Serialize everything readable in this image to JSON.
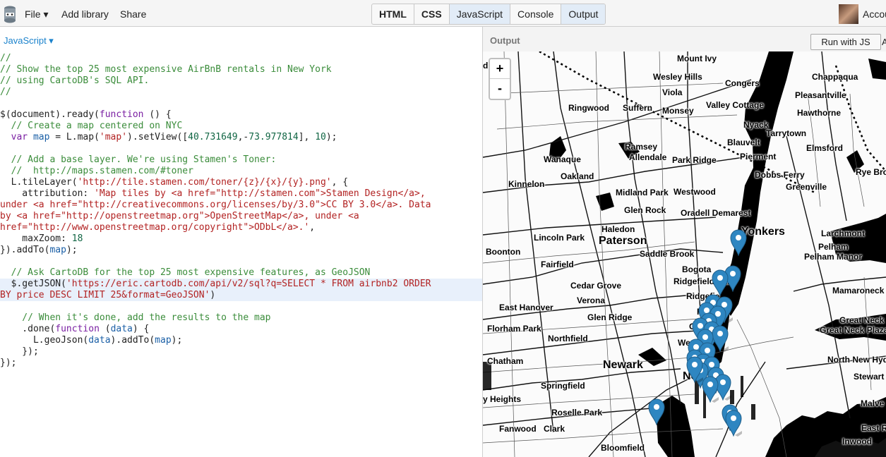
{
  "toolbar": {
    "file_label": "File ▾",
    "add_library_label": "Add library",
    "share_label": "Share",
    "tabs": [
      "HTML",
      "CSS",
      "JavaScript",
      "Console",
      "Output"
    ],
    "account_label": "Accou"
  },
  "editor": {
    "language": "JavaScript ▾",
    "code_lines": [
      [
        [
          "//",
          "c"
        ]
      ],
      [
        [
          "// Show the top 25 most expensive AirBnB rentals in New York",
          "c"
        ]
      ],
      [
        [
          "// using CartoDB's SQL API.",
          "c"
        ]
      ],
      [
        [
          "//",
          "c"
        ]
      ],
      [],
      [
        [
          "$(document).ready(",
          "p"
        ],
        [
          "function",
          "k"
        ],
        [
          " () {",
          "p"
        ]
      ],
      [
        [
          "  // Create a map centered on NYC",
          "c"
        ]
      ],
      [
        [
          "  ",
          "p"
        ],
        [
          "var",
          "k"
        ],
        [
          " ",
          "p"
        ],
        [
          "map",
          "v"
        ],
        [
          " = L.map(",
          "p"
        ],
        [
          "'map'",
          "s"
        ],
        [
          ").setView([",
          "p"
        ],
        [
          "40.731649",
          "n"
        ],
        [
          ",-",
          "p"
        ],
        [
          "73.977814",
          "n"
        ],
        [
          "], ",
          "p"
        ],
        [
          "10",
          "n"
        ],
        [
          ");",
          "p"
        ]
      ],
      [],
      [
        [
          "  // Add a base layer. We're using Stamen's Toner:",
          "c"
        ]
      ],
      [
        [
          "  //  http://maps.stamen.com/#toner",
          "c"
        ]
      ],
      [
        [
          "  L.tileLayer(",
          "p"
        ],
        [
          "'http://tile.stamen.com/toner/{z}/{x}/{y}.png'",
          "s"
        ],
        [
          ", {",
          "p"
        ]
      ],
      [
        [
          "    attribution: ",
          "p"
        ],
        [
          "'Map tiles by <a href=\"http://stamen.com\">Stamen Design</a>,",
          "s"
        ]
      ],
      [
        [
          "under <a href=\"http://creativecommons.org/licenses/by/3.0\">CC BY 3.0</a>. Data",
          "s"
        ]
      ],
      [
        [
          "by <a href=\"http://openstreetmap.org\">OpenStreetMap</a>, under <a",
          "s"
        ]
      ],
      [
        [
          "href=\"http://www.openstreetmap.org/copyright\">ODbL</a>.'",
          "s"
        ],
        [
          ",",
          "p"
        ]
      ],
      [
        [
          "    maxZoom: ",
          "p"
        ],
        [
          "18",
          "n"
        ]
      ],
      [
        [
          "}).addTo(",
          "p"
        ],
        [
          "map",
          "v"
        ],
        [
          ");",
          "p"
        ]
      ],
      [],
      [
        [
          "  // Ask CartoDB for the top 25 most expensive features, as GeoJSON",
          "c"
        ]
      ],
      [
        [
          "  $.getJSON(",
          "p"
        ],
        [
          "'https://eric.cartodb.com/api/v2/sql?q=SELECT * FROM airbnb2 ORDER",
          "s"
        ]
      ],
      [
        [
          "BY price DESC LIMIT 25&format=GeoJSON'",
          "s"
        ],
        [
          ")",
          "p"
        ]
      ],
      [],
      [
        [
          "    // When it's done, add the results to the map",
          "c"
        ]
      ],
      [
        [
          "    .done(",
          "p"
        ],
        [
          "function",
          "k"
        ],
        [
          " (",
          "p"
        ],
        [
          "data",
          "v"
        ],
        [
          ") {",
          "p"
        ]
      ],
      [
        [
          "      L.geoJson(",
          "p"
        ],
        [
          "data",
          "v"
        ],
        [
          ").addTo(",
          "p"
        ],
        [
          "map",
          "v"
        ],
        [
          ");",
          "p"
        ]
      ],
      [
        [
          "    });",
          "p"
        ]
      ],
      [
        [
          "});",
          "p"
        ]
      ]
    ],
    "highlighted_lines": [
      20,
      21
    ]
  },
  "output": {
    "label": "Output",
    "run_button": "Run with JS",
    "run_extra": "A",
    "zoom_in": "+",
    "zoom_out": "-",
    "place_labels": [
      {
        "text": "Mount Ivy",
        "size": "s"
      },
      {
        "text": "Wesley Hills",
        "size": "s"
      },
      {
        "text": "Congers",
        "size": "s"
      },
      {
        "text": "Chappaqua",
        "size": "s"
      },
      {
        "text": "Viola",
        "size": "s"
      },
      {
        "text": "Pleasantville",
        "size": "s"
      },
      {
        "text": "d",
        "size": "s"
      },
      {
        "text": "Ringwood",
        "size": "s"
      },
      {
        "text": "Suffern",
        "size": "s"
      },
      {
        "text": "Monsey",
        "size": "s"
      },
      {
        "text": "Valley Cottage",
        "size": "s"
      },
      {
        "text": "Hawthorne",
        "size": "s"
      },
      {
        "text": "Nyack",
        "size": "s"
      },
      {
        "text": "Tarrytown",
        "size": "s"
      },
      {
        "text": "Blauvelt",
        "size": "s"
      },
      {
        "text": "Ramsey",
        "size": "s"
      },
      {
        "text": "Elmsford",
        "size": "s"
      },
      {
        "text": "Allendale",
        "size": "s"
      },
      {
        "text": "Pierment",
        "size": "s"
      },
      {
        "text": "Wanaque",
        "size": "s"
      },
      {
        "text": "Park Ridge",
        "size": "s"
      },
      {
        "text": "Rye Bro",
        "size": "s"
      },
      {
        "text": "Oakland",
        "size": "s"
      },
      {
        "text": "Dobbs Ferry",
        "size": "s"
      },
      {
        "text": "Kinnelon",
        "size": "s"
      },
      {
        "text": "Greenville",
        "size": "s"
      },
      {
        "text": "Westwood",
        "size": "s"
      },
      {
        "text": "Midland Park",
        "size": "s"
      },
      {
        "text": "Glen Rock",
        "size": "s"
      },
      {
        "text": "Oradell Demarest",
        "size": "s"
      },
      {
        "text": "Yonkers",
        "size": "b"
      },
      {
        "text": "Haledon",
        "size": "s"
      },
      {
        "text": "Larchmont",
        "size": "s"
      },
      {
        "text": "Lincoln Park",
        "size": "s"
      },
      {
        "text": "Paterson",
        "size": "b"
      },
      {
        "text": "Pelham",
        "size": "s"
      },
      {
        "text": "Boonton",
        "size": "s"
      },
      {
        "text": "Saddle Brook",
        "size": "s"
      },
      {
        "text": "Pelham Manor",
        "size": "s"
      },
      {
        "text": "Fairfield",
        "size": "s"
      },
      {
        "text": "Bogota",
        "size": "s"
      },
      {
        "text": "Ridgefield Park",
        "size": "s"
      },
      {
        "text": "Mamaroneck",
        "size": "s"
      },
      {
        "text": "Cedar Grove",
        "size": "s"
      },
      {
        "text": "Verona",
        "size": "s"
      },
      {
        "text": "Ridgefie",
        "size": "s"
      },
      {
        "text": "East Hanover",
        "size": "s"
      },
      {
        "text": "Fairvie",
        "size": "s"
      },
      {
        "text": "Glen Ridge",
        "size": "s"
      },
      {
        "text": "Great Neck",
        "size": "s"
      },
      {
        "text": "Florham Park",
        "size": "s"
      },
      {
        "text": "Gutte",
        "size": "s"
      },
      {
        "text": "Great Neck Plaza",
        "size": "s"
      },
      {
        "text": "Northfield",
        "size": "s"
      },
      {
        "text": "Weeha",
        "size": "s"
      },
      {
        "text": "Chatham",
        "size": "s"
      },
      {
        "text": "Newark",
        "size": "b"
      },
      {
        "text": "North New Hyde",
        "size": "s"
      },
      {
        "text": "New",
        "size": "b"
      },
      {
        "text": "Stewart M",
        "size": "s"
      },
      {
        "text": "Springfield",
        "size": "s"
      },
      {
        "text": "y Heights",
        "size": "s"
      },
      {
        "text": "Malve",
        "size": "s"
      },
      {
        "text": "Roselle Park",
        "size": "s"
      },
      {
        "text": "Fanwood",
        "size": "s"
      },
      {
        "text": "Clark",
        "size": "s"
      },
      {
        "text": "East Ros",
        "size": "s"
      },
      {
        "text": "Inwood",
        "size": "s"
      },
      {
        "text": "Bloomfield",
        "size": "s"
      }
    ],
    "marker_count": 25
  },
  "colors": {
    "accent": "#1a82cc",
    "marker": "#2e86c1",
    "comment": "#3a8c3a",
    "keyword": "#7a1fa2",
    "string": "#b22222",
    "number": "#116644",
    "variable": "#1a5fa6"
  }
}
